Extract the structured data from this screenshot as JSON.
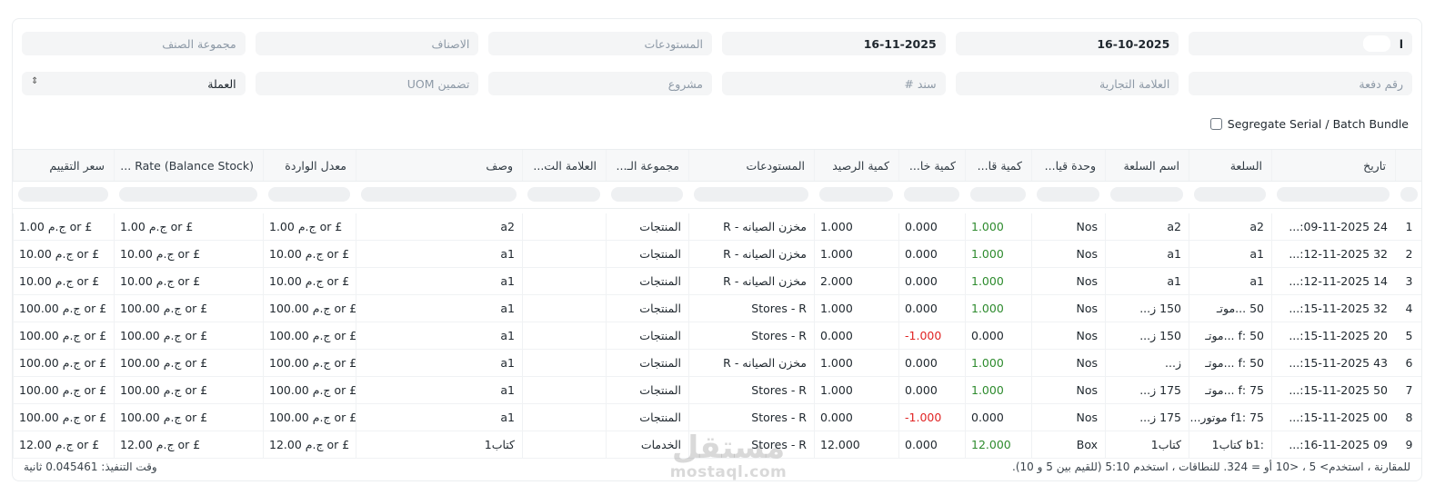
{
  "filters": {
    "row1": [
      {
        "key": "company",
        "value": "ا",
        "placeholder": ""
      },
      {
        "key": "from_date",
        "value": "16-10-2025",
        "placeholder": ""
      },
      {
        "key": "to_date",
        "value": "16-11-2025",
        "placeholder": ""
      },
      {
        "key": "warehouses",
        "value": "",
        "placeholder": "المستودعات"
      },
      {
        "key": "items",
        "value": "",
        "placeholder": "الاصناف"
      },
      {
        "key": "item_group",
        "value": "",
        "placeholder": "مجموعة الصنف"
      }
    ],
    "row2": [
      {
        "key": "batch_no",
        "value": "",
        "placeholder": "رقم دفعة"
      },
      {
        "key": "brand",
        "value": "",
        "placeholder": "العلامة التجارية"
      },
      {
        "key": "voucher_no",
        "value": "",
        "placeholder": "سند #"
      },
      {
        "key": "project",
        "value": "",
        "placeholder": "مشروع"
      },
      {
        "key": "include_uom",
        "value": "",
        "placeholder": "تضمين UOM"
      },
      {
        "key": "currency",
        "value": "العملة",
        "placeholder": ""
      }
    ]
  },
  "segregate_label": "Segregate Serial / Batch Bundle",
  "columns": [
    {
      "key": "date",
      "label": "تاريخ"
    },
    {
      "key": "item",
      "label": "السلعة"
    },
    {
      "key": "item_name",
      "label": "اسم السلعة"
    },
    {
      "key": "uom",
      "label": "وحدة قيا..."
    },
    {
      "key": "in_qty",
      "label": "كمية قا..."
    },
    {
      "key": "out_qty",
      "label": "كمية خا..."
    },
    {
      "key": "balance_qty",
      "label": "كمية الرصيد"
    },
    {
      "key": "warehouse",
      "label": "المستودعات"
    },
    {
      "key": "item_group",
      "label": "مجموعة الـ..."
    },
    {
      "key": "brand",
      "label": "العلامة الت..."
    },
    {
      "key": "description",
      "label": "وصف"
    },
    {
      "key": "incoming_rate",
      "label": "معدل الواردة"
    },
    {
      "key": "balance_rate",
      "label": "Rate (Balance Stock) ..."
    },
    {
      "key": "valuation_rate",
      "label": "سعر التقييم"
    }
  ],
  "rows": [
    {
      "n": "1",
      "date": "24 09-11-2025:...",
      "item": "a2",
      "item_name": "a2",
      "uom": "Nos",
      "in_qty": "1.000",
      "out_qty": "0.000",
      "balance_qty": "1.000",
      "warehouse": "مخزن الصيانه - R",
      "item_group": "المنتجات",
      "brand": "",
      "description": "a2",
      "incoming_rate": "£ or ج.م 1.00",
      "balance_rate": "£ or ج.م 1.00",
      "valuation_rate": "£ or ج.م 1.00",
      "in_color": "green",
      "out_color": ""
    },
    {
      "n": "2",
      "date": "32 12-11-2025:...",
      "item": "a1",
      "item_name": "a1",
      "uom": "Nos",
      "in_qty": "1.000",
      "out_qty": "0.000",
      "balance_qty": "1.000",
      "warehouse": "مخزن الصيانه - R",
      "item_group": "المنتجات",
      "brand": "",
      "description": "a1",
      "incoming_rate": "£ or ج.م 10.00",
      "balance_rate": "£ or ج.م 10.00",
      "valuation_rate": "£ or ج.م 10.00",
      "in_color": "green",
      "out_color": ""
    },
    {
      "n": "3",
      "date": "14 12-11-2025:...",
      "item": "a1",
      "item_name": "a1",
      "uom": "Nos",
      "in_qty": "1.000",
      "out_qty": "0.000",
      "balance_qty": "2.000",
      "warehouse": "مخزن الصيانه - R",
      "item_group": "المنتجات",
      "brand": "",
      "description": "a1",
      "incoming_rate": "£ or ج.م 10.00",
      "balance_rate": "£ or ج.م 10.00",
      "valuation_rate": "£ or ج.م 10.00",
      "in_color": "green",
      "out_color": ""
    },
    {
      "n": "4",
      "date": "32 15-11-2025:...",
      "item": "50 ...موتـ",
      "item_name": "150 ز...",
      "uom": "Nos",
      "in_qty": "1.000",
      "out_qty": "0.000",
      "balance_qty": "1.000",
      "warehouse": "Stores - R",
      "item_group": "المنتجات",
      "brand": "",
      "description": "a1",
      "incoming_rate": "£ or ج.م 100.00",
      "balance_rate": "£ or ج.م 100.00",
      "valuation_rate": "£ or ج.م 100.00",
      "in_color": "green",
      "out_color": ""
    },
    {
      "n": "5",
      "date": "20 15-11-2025:...",
      "item": "50 :f ...موتـ",
      "item_name": "150 ز...",
      "uom": "Nos",
      "in_qty": "0.000",
      "out_qty": "1.000-",
      "balance_qty": "0.000",
      "warehouse": "Stores - R",
      "item_group": "المنتجات",
      "brand": "",
      "description": "a1",
      "incoming_rate": "£ or ج.م 100.00",
      "balance_rate": "£ or ج.م 100.00",
      "valuation_rate": "£ or ج.م 100.00",
      "in_color": "",
      "out_color": "red"
    },
    {
      "n": "6",
      "date": "43 15-11-2025:...",
      "item": "50 :f ...موتـ",
      "item_name": "ز...",
      "uom": "Nos",
      "in_qty": "1.000",
      "out_qty": "0.000",
      "balance_qty": "1.000",
      "warehouse": "مخزن الصيانه - R",
      "item_group": "المنتجات",
      "brand": "",
      "description": "a1",
      "incoming_rate": "£ or ج.م 100.00",
      "balance_rate": "£ or ج.م 100.00",
      "valuation_rate": "£ or ج.م 100.00",
      "in_color": "green",
      "out_color": ""
    },
    {
      "n": "7",
      "date": "50 15-11-2025:...",
      "item": "75 :f ...موتـ",
      "item_name": "175 ز...",
      "uom": "Nos",
      "in_qty": "1.000",
      "out_qty": "0.000",
      "balance_qty": "1.000",
      "warehouse": "Stores - R",
      "item_group": "المنتجات",
      "brand": "",
      "description": "a1",
      "incoming_rate": "£ or ج.م 100.00",
      "balance_rate": "£ or ج.م 100.00",
      "valuation_rate": "£ or ج.م 100.00",
      "in_color": "green",
      "out_color": ""
    },
    {
      "n": "8",
      "date": "00 15-11-2025:...",
      "item": "75 :f1 موتور...",
      "item_name": "175 ز...",
      "uom": "Nos",
      "in_qty": "0.000",
      "out_qty": "1.000-",
      "balance_qty": "0.000",
      "warehouse": "Stores - R",
      "item_group": "المنتجات",
      "brand": "",
      "description": "a1",
      "incoming_rate": "£ or ج.م 100.00",
      "balance_rate": "£ or ج.م 100.00",
      "valuation_rate": "£ or ج.م 100.00",
      "in_color": "",
      "out_color": "red"
    },
    {
      "n": "9",
      "date": "09 16-11-2025:...",
      "item": ":b1 كتاب1",
      "item_name": "كتاب1",
      "uom": "Box",
      "in_qty": "12.000",
      "out_qty": "0.000",
      "balance_qty": "12.000",
      "warehouse": "Stores - R",
      "item_group": "الخدمات",
      "brand": "",
      "description": "كتاب1",
      "incoming_rate": "£ or ج.م 12.00",
      "balance_rate": "£ or ج.م 12.00",
      "valuation_rate": "£ or ج.م 12.00",
      "in_color": "green",
      "out_color": ""
    }
  ],
  "footer": {
    "hint": "للمقارنة ، استخدم> 5 ، <10 أو = 324. للنطاقات ، استخدم 5:10 (للقيم بين 5 و 10).",
    "exec_time": "وقت التنفيذ: 0.045461 ثانية"
  },
  "watermark": {
    "arabic": "مستقل",
    "latin": "mostaql.com"
  }
}
